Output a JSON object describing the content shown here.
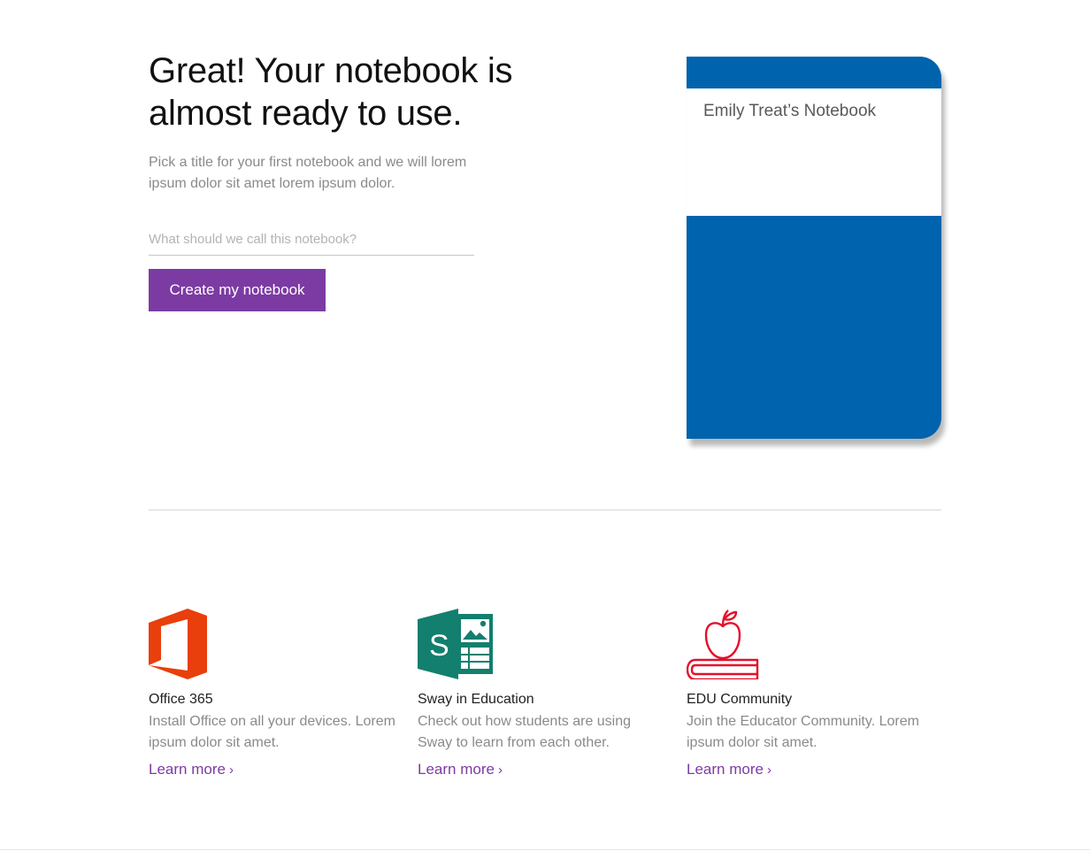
{
  "hero": {
    "title": "Great! Your notebook is almost ready to use.",
    "subtitle": "Pick a title for your first notebook and we will lorem ipsum dolor sit amet lorem ipsum dolor.",
    "input_placeholder": "What should we call this notebook?",
    "input_value": "",
    "create_button": "Create my notebook"
  },
  "notebook_preview": {
    "title": "Emily Treat’s Notebook",
    "cover_color": "#0063ad"
  },
  "cards": [
    {
      "icon": "office-365-icon",
      "title": "Office 365",
      "description": "Install Office on all your devices. Lorem ipsum dolor sit amet.",
      "link": "Learn more",
      "link_chevron": "›"
    },
    {
      "icon": "sway-icon",
      "title": "Sway in Education",
      "description": "Check out how students are using Sway to learn from each other.",
      "link": "Learn more",
      "link_chevron": "›"
    },
    {
      "icon": "apple-book-icon",
      "title": "EDU Community",
      "description": "Join the Educator Community. Lorem ipsum dolor sit amet.",
      "link": "Learn more",
      "link_chevron": "›"
    }
  ],
  "colors": {
    "accent_purple": "#7c3ba3",
    "notebook_blue": "#0063ad",
    "office_orange": "#e83f0c",
    "sway_green": "#137f6e",
    "edu_red": "#e3102a"
  }
}
